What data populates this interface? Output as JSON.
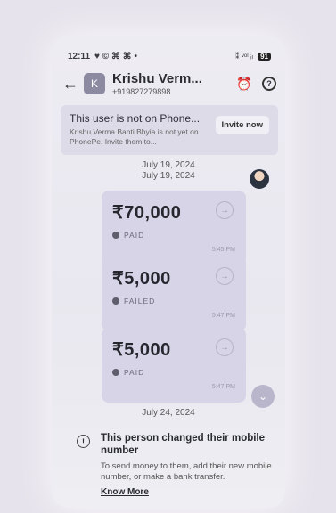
{
  "status_bar": {
    "time": "12:11",
    "left_icons": "♥ © ⌘ ⌘ •",
    "signal": "⁑ ᵛᵒˡ ᵢₗ",
    "battery": "91"
  },
  "header": {
    "back_icon": "←",
    "avatar_letter": "K",
    "contact_name": "Krishu Verm...",
    "contact_phone": "+919827279898",
    "reminder_icon": "⏰",
    "help_icon": "?"
  },
  "banner": {
    "title": "This user is not on Phone...",
    "subtitle": "Krishu Verma Banti Bhyia is not yet on PhonePe. Invite them to...",
    "invite_label": "Invite now"
  },
  "dates": {
    "first": "July 19, 2024",
    "second": "July 19, 2024",
    "third": "July 24, 2024"
  },
  "transactions": [
    {
      "amount": "₹70,000",
      "status": "PAID",
      "time": "5:45 PM"
    },
    {
      "amount": "₹5,000",
      "status": "FAILED",
      "time": "5:47 PM"
    },
    {
      "amount": "₹5,000",
      "status": "PAID",
      "time": "5:47 PM"
    }
  ],
  "notice": {
    "title": "This person changed their mobile number",
    "body": "To send money to them, add their new mobile number, or make a bank transfer.",
    "link": "Know More"
  },
  "colors": {
    "card_bg": "#d6d4e6",
    "banner_bg": "#dddbe8",
    "scroll_btn": "#b9b6cc"
  }
}
